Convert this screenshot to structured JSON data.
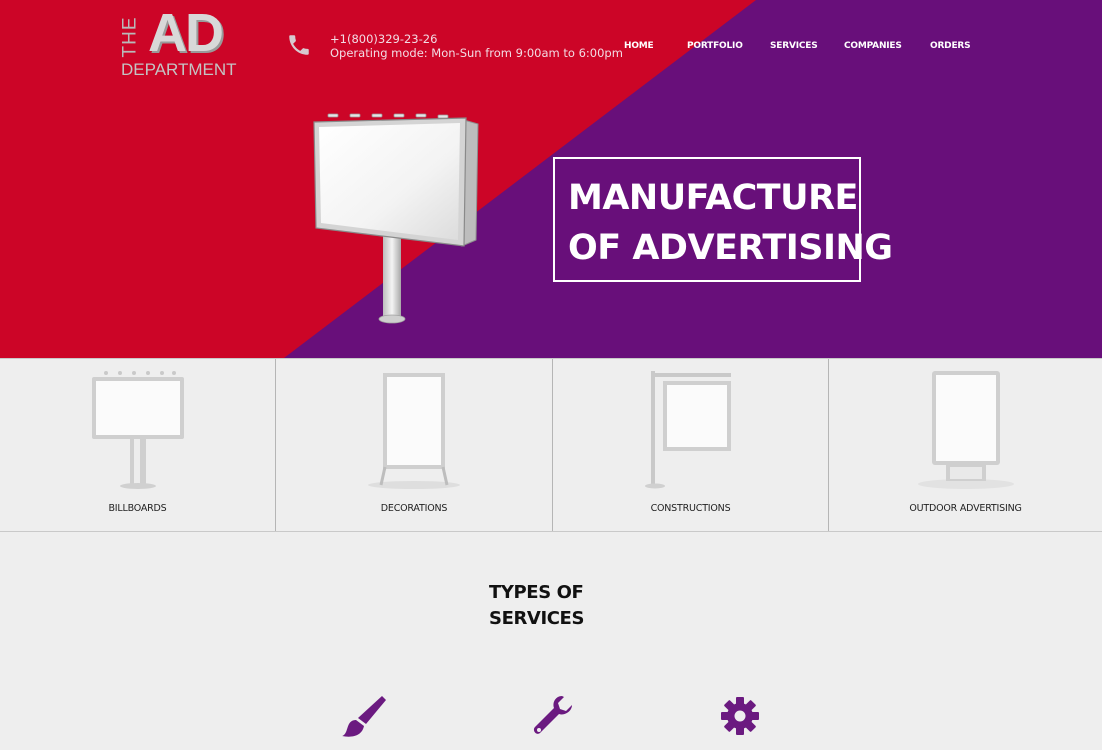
{
  "brand": {
    "logo_the": "THE",
    "logo_ad": "AD",
    "logo_department": "DEPARTMENT"
  },
  "contact": {
    "phone": "+1(800)329-23-26",
    "hours": "Operating mode: Mon-Sun from 9:00am to 6:00pm",
    "icon": "phone-icon"
  },
  "nav": {
    "items": [
      "HOME",
      "PORTFOLIO",
      "SERVICES",
      "COMPANIES",
      "ORDERS"
    ]
  },
  "hero": {
    "headline_line1": "MANUFACTURE",
    "headline_line2": "OF ADVERTISING",
    "colors": {
      "red": "#cc0527",
      "purple": "#680f7a"
    }
  },
  "categories": {
    "items": [
      "BILLBOARDS",
      "DECORATIONS",
      "CONSTRUCTIONS",
      "OUTDOOR ADVERTISING"
    ]
  },
  "services": {
    "title_line1": "TYPES OF",
    "title_line2": "SERVICES",
    "icons": [
      "paint-brush-icon",
      "wrench-icon",
      "gear-icon"
    ],
    "icon_color": "#6b1a80"
  }
}
